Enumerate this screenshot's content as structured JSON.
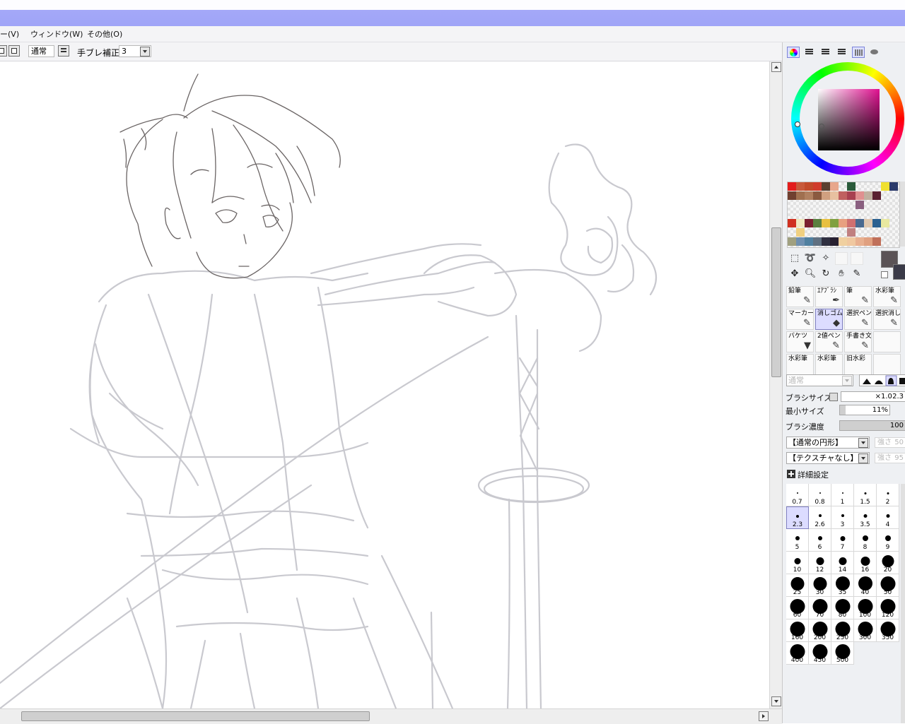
{
  "menu": [
    "ー(V)",
    "ウィンドウ(W)",
    "その他(O)"
  ],
  "toolbar": {
    "blend_mode": "通常",
    "stabilizer_label": "手ブレ補正",
    "stabilizer_value": "3"
  },
  "colors": {
    "titlebar": "#9fa4f7",
    "selection": "#dcdcff",
    "main_color": "#5a5356",
    "sub_color": "#3a3a48",
    "sketch_gray": "#c9c9cf",
    "sketch_dark": "#6a6464"
  },
  "panel_tabs": [
    "color-wheel-icon",
    "rgb-slider-icon",
    "hsv-slider-icon",
    "history-icon",
    "swatch-grid-icon",
    "scratchpad-icon"
  ],
  "swatches": [
    [
      "#e31c1c",
      "#c8593a",
      "#c24a2a",
      "#d03c2c",
      "#5a4030",
      "#e8a78c",
      "#fff",
      "#2a5a3a",
      "#fff",
      "#fff",
      "#fff",
      "#f0e030",
      "#2a3a6a"
    ],
    [
      "#704030",
      "#a07050",
      "#b08060",
      "#8a5a40",
      "#d0a080",
      "#e8c0a0",
      "#c06060",
      "#a84050",
      "#e09090",
      "#c0b0a0",
      "#5a2030",
      "#fff",
      "#fff"
    ],
    [
      "#fff",
      "#fff",
      "#fff",
      "#fff",
      "#fff",
      "#fff",
      "#fff",
      "#fff",
      "#8a6080",
      "#fff",
      "#fff",
      "#fff",
      "#fff"
    ],
    [
      "#fff",
      "#fff",
      "#fff",
      "#fff",
      "#fff",
      "#fff",
      "#fff",
      "#fff",
      "#fff",
      "#fff",
      "#fff",
      "#fff",
      "#fff"
    ],
    [
      "#d03020",
      "#f0e8c0",
      "#7a2030",
      "#5a8040",
      "#e8c040",
      "#80a040",
      "#e8a080",
      "#d07070",
      "#4a6a90",
      "#e0c8b0",
      "#2a6090",
      "#e8e8a0",
      "#fff"
    ],
    [
      "#fff",
      "#f0d080",
      "#fff",
      "#fff",
      "#fff",
      "#fff",
      "#fff",
      "#c08080",
      "#fff",
      "#fff",
      "#fff",
      "#fff",
      "#fff"
    ],
    [
      "#a0a080",
      "#7090b0",
      "#5080a0",
      "#607080",
      "#303040",
      "#282030",
      "#f0d0a0",
      "#f0c8a0",
      "#e8b090",
      "#e0a080",
      "#c0705a",
      "#fff",
      "#fff"
    ]
  ],
  "select_tools": [
    "select-rect-icon",
    "lasso-icon",
    "magic-wand-icon",
    "blank",
    "blank"
  ],
  "nav_tools": [
    "move-icon",
    "zoom-icon",
    "rotate-icon",
    "hand-icon",
    "eyedropper-icon"
  ],
  "tools": [
    {
      "label": "鉛筆",
      "icon": "pencil-icon",
      "glyph": "✎",
      "selected": false
    },
    {
      "label": "ｴｱﾌﾞﾗｼ",
      "icon": "airbrush-icon",
      "glyph": "✒",
      "selected": false
    },
    {
      "label": "筆",
      "icon": "brush-icon",
      "glyph": "✎",
      "selected": false
    },
    {
      "label": "水彩筆",
      "icon": "watercolor-icon",
      "glyph": "✎",
      "selected": false
    },
    {
      "label": "マーカー",
      "icon": "marker-icon",
      "glyph": "✎",
      "selected": false
    },
    {
      "label": "消しゴム",
      "icon": "eraser-icon",
      "glyph": "◆",
      "selected": true
    },
    {
      "label": "選択ペン",
      "icon": "select-pen-icon",
      "glyph": "✎",
      "selected": false
    },
    {
      "label": "選択消し",
      "icon": "select-erase-icon",
      "glyph": "✎",
      "selected": false
    },
    {
      "label": "バケツ",
      "icon": "bucket-icon",
      "glyph": "▼",
      "selected": false
    },
    {
      "label": "2値ペン",
      "icon": "binary-pen-icon",
      "glyph": "✎",
      "selected": false
    },
    {
      "label": "手書き文",
      "icon": "handwriting-icon",
      "glyph": "✎",
      "selected": false
    },
    {
      "label": "",
      "icon": "empty",
      "glyph": "",
      "selected": false
    },
    {
      "label": "水彩筆",
      "icon": "watercolor2-icon",
      "glyph": "",
      "selected": false
    },
    {
      "label": "水彩筆",
      "icon": "watercolor3-icon",
      "glyph": "",
      "selected": false
    },
    {
      "label": "旧水彩",
      "icon": "old-watercolor-icon",
      "glyph": "",
      "selected": false
    },
    {
      "label": "",
      "icon": "empty",
      "glyph": "",
      "selected": false
    }
  ],
  "brush": {
    "mode_placeholder": "通常",
    "size_label": "ブラシサイズ",
    "size_multiplier": "×1.0",
    "size_value": "2.3",
    "min_size_label": "最小サイズ",
    "min_size_value": "11%",
    "min_size_fraction": 0.11,
    "density_label": "ブラシ濃度",
    "density_value": "100",
    "density_fraction": 1.0,
    "shape": "【通常の円形】",
    "texture": "【テクスチャなし】",
    "strength_label": "強さ",
    "strength_value": "50",
    "strength_value2": "95",
    "details_label": "詳細設定"
  },
  "brush_sizes": [
    "0.7",
    "0.8",
    "1",
    "1.5",
    "2",
    "2.3",
    "2.6",
    "3",
    "3.5",
    "4",
    "5",
    "6",
    "7",
    "8",
    "9",
    "10",
    "12",
    "14",
    "16",
    "20",
    "25",
    "30",
    "35",
    "40",
    "50",
    "60",
    "70",
    "80",
    "100",
    "120",
    "160",
    "200",
    "250",
    "300",
    "350",
    "400",
    "450",
    "500"
  ],
  "selected_brush_size": "2.3",
  "brush_tip_fill": [
    0.05,
    0.06,
    0.07,
    0.09,
    0.11,
    0.12,
    0.13,
    0.14,
    0.16,
    0.17,
    0.19,
    0.21,
    0.23,
    0.25,
    0.27,
    0.3,
    0.35,
    0.38,
    0.44,
    0.55,
    0.62,
    0.64,
    0.66,
    0.68,
    0.7,
    0.7,
    0.7,
    0.7,
    0.7,
    0.7,
    0.7,
    0.7,
    0.7,
    0.7,
    0.7,
    0.7,
    0.7,
    0.7
  ]
}
